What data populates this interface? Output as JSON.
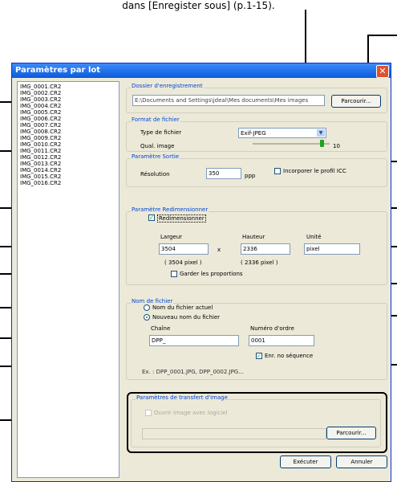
{
  "caption": "dans [Enregister sous] (p.1-15).",
  "dialog": {
    "title": "Paramètres par lot",
    "close_glyph": "✕"
  },
  "files": [
    "IMG_0001.CR2",
    "IMG_0002.CR2",
    "IMG_0003.CR2",
    "IMG_0004.CR2",
    "IMG_0005.CR2",
    "IMG_0006.CR2",
    "IMG_0007.CR2",
    "IMG_0008.CR2",
    "IMG_0009.CR2",
    "IMG_0010.CR2",
    "IMG_0011.CR2",
    "IMG_0012.CR2",
    "IMG_0013.CR2",
    "IMG_0014.CR2",
    "IMG_0015.CR2",
    "IMG_0016.CR2"
  ],
  "save_folder": {
    "title": "Dossier d'enregistrement",
    "path": "E:\\Documents and Settings\\jdeal\\Mes documents\\Mes images",
    "browse": "Parcourir..."
  },
  "file_format": {
    "title": "Format de fichier",
    "type_label": "Type de fichier",
    "type_value": "Exif-JPEG",
    "quality_label": "Qual. image",
    "quality_value": "10",
    "quality_fraction": 0.9
  },
  "output": {
    "title": "Paramètre Sortie",
    "resolution_label": "Résolution",
    "resolution_value": "350",
    "unit": "ppp",
    "icc_label": "Incorporer le profil ICC"
  },
  "resize": {
    "title": "Paramètre Redimensionner",
    "checkbox_label": "Redimensionner",
    "width_label": "Largeur",
    "width_value": "3504",
    "width_pixel": "( 3504 pixel )",
    "times": "x",
    "height_label": "Hauteur",
    "height_value": "2336",
    "height_pixel": "( 2336 pixel )",
    "unit_label": "Unité",
    "unit_value": "pixel",
    "keep_ratio": "Garder les  proportions"
  },
  "filename": {
    "title": "Nom de fichier",
    "current_name": "Nom du fichier actuel",
    "new_name": "Nouveau nom du fichier",
    "string_label": "Chaîne",
    "string_value": "DPP_",
    "order_label": "Numéro d'ordre",
    "order_value": "0001",
    "seq_label": "Enr. no séquence",
    "example": "Ex. :   DPP_0001.JPG, DPP_0002.JPG..."
  },
  "transfer": {
    "title": "Paramètres de transfert d'image",
    "open_with": "Ouvrir image avec logiciel",
    "browse": "Parcourir..."
  },
  "buttons": {
    "execute": "Exécuter",
    "cancel": "Annuler"
  },
  "colors": {
    "title_bar": "#0a5bde",
    "group_title": "#0046d5",
    "check": "#21a121"
  }
}
